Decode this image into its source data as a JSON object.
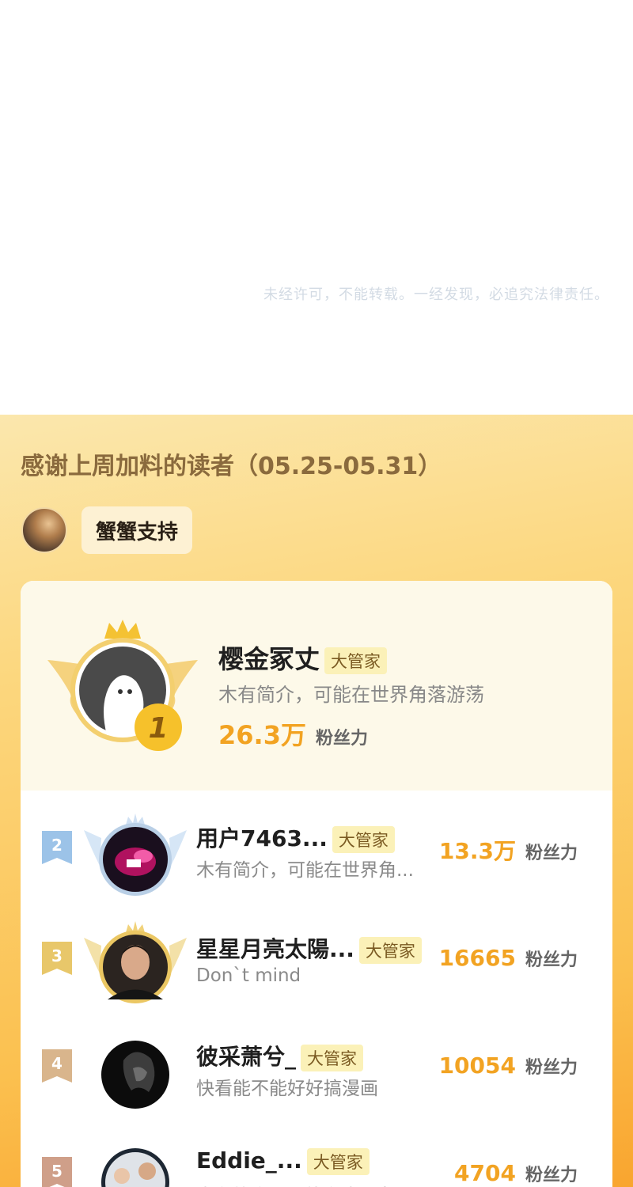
{
  "notice": "未经许可，不能转载。一经发现，必追究法律责任。",
  "supporters": {
    "title": "感谢上周加料的读者（05.25-05.31）",
    "support_label": "蟹蟹支持",
    "top": {
      "rank": "1",
      "name": "樱金冢丈",
      "tag": "大管家",
      "desc": "木有简介，可能在世界角落游荡",
      "score": "26.3万",
      "score_unit": "粉丝力"
    },
    "rows": [
      {
        "rank": "2",
        "name": "用户7463...",
        "tag": "大管家",
        "desc": "木有简介，可能在世界角...",
        "score": "13.3万",
        "score_unit": "粉丝力"
      },
      {
        "rank": "3",
        "name": "星星月亮太陽...",
        "tag": "大管家",
        "desc": "Don`t mind",
        "score": "16665",
        "score_unit": "粉丝力"
      },
      {
        "rank": "4",
        "name": "彼采萧兮_",
        "tag": "大管家",
        "desc": "快看能不能好好搞漫画",
        "score": "10054",
        "score_unit": "粉丝力"
      },
      {
        "rank": "5",
        "name": "Eddie_...",
        "tag": "大管家",
        "desc": "木有简介，可能在世界角...",
        "score": "4704",
        "score_unit": "粉丝力"
      }
    ]
  },
  "colors": {
    "accent": "#f2a322",
    "rank2": "#9cc3e8",
    "rank3": "#e8c76a",
    "rank4": "#d9b58c",
    "rank5": "#cf9f89"
  }
}
